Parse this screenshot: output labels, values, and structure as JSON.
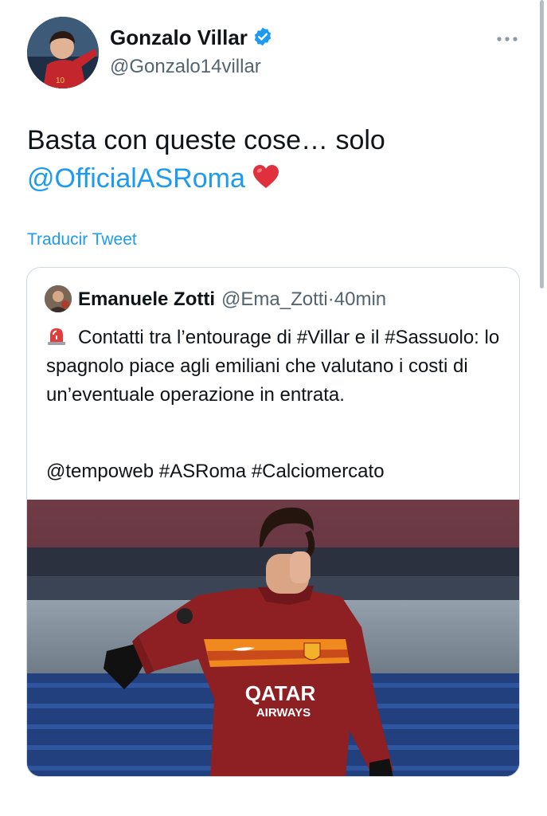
{
  "author": {
    "display_name": "Gonzalo Villar",
    "handle": "@Gonzalo14villar",
    "verified": true,
    "avatar_icon": "player-avatar",
    "verified_icon": "verified-badge-icon"
  },
  "tweet": {
    "text": "Basta con queste cose… solo",
    "mention": "@OfficialASRoma",
    "emoji": "❤️",
    "translate_label": "Traducir Tweet"
  },
  "quote": {
    "display_name": "Emanuele Zotti",
    "handle": "@Ema_Zotti",
    "separator": "·",
    "time": "40min",
    "emoji": "🚨",
    "body": "Contatti tra l’entourage di #Villar e il #Sassuolo: lo spagnolo piace agli emiliani che valutano i costi di un’eventuale operazione in entrata.",
    "tags": "@tempoweb #ASRoma #Calciomercato",
    "photo_sponsor_line1": "QATAR",
    "photo_sponsor_line2": "AIRWAYS"
  },
  "colors": {
    "link": "#1d9bf0",
    "secondary_text": "#536471",
    "border": "#cfd9de",
    "jersey": "#8e1f22"
  }
}
